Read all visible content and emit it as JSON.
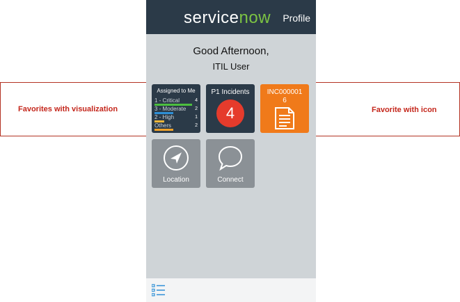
{
  "header": {
    "logo_service": "service",
    "logo_now": "now",
    "profile_label": "Profile"
  },
  "greeting": {
    "line1": "Good Afternoon,",
    "line2": "ITIL User"
  },
  "tiles": {
    "assigned": {
      "title": "Assigned to Me",
      "rows": [
        {
          "label": "1 - Critical",
          "count": "4",
          "color": "#4cbf3f",
          "fraction": 1.0
        },
        {
          "label": "3 - Moderate",
          "count": "2",
          "color": "#2e8fd6",
          "fraction": 0.5
        },
        {
          "label": "2 - High",
          "count": "1",
          "color": "#f0b63a",
          "fraction": 0.25
        },
        {
          "label": "Others",
          "count": "2",
          "color": "#f0a12a",
          "fraction": 0.5
        }
      ]
    },
    "p1": {
      "title": "P1 Incidents",
      "count": "4"
    },
    "inc": {
      "title_line1": "INC000001",
      "title_line2": "6"
    },
    "location": {
      "label": "Location"
    },
    "connect": {
      "label": "Connect"
    }
  },
  "annotations": {
    "left": "Favorites with visualization",
    "right": "Favorite with icon"
  },
  "icons": {
    "list": "list-icon",
    "document": "document-icon",
    "location": "navigation-arrow-icon",
    "connect": "chat-bubble-icon"
  },
  "colors": {
    "header": "#2b3a48",
    "accent_green": "#7cc343",
    "p1_red": "#e53b2c",
    "inc_orange": "#f07a1a",
    "annotation_red": "#c4261b"
  }
}
